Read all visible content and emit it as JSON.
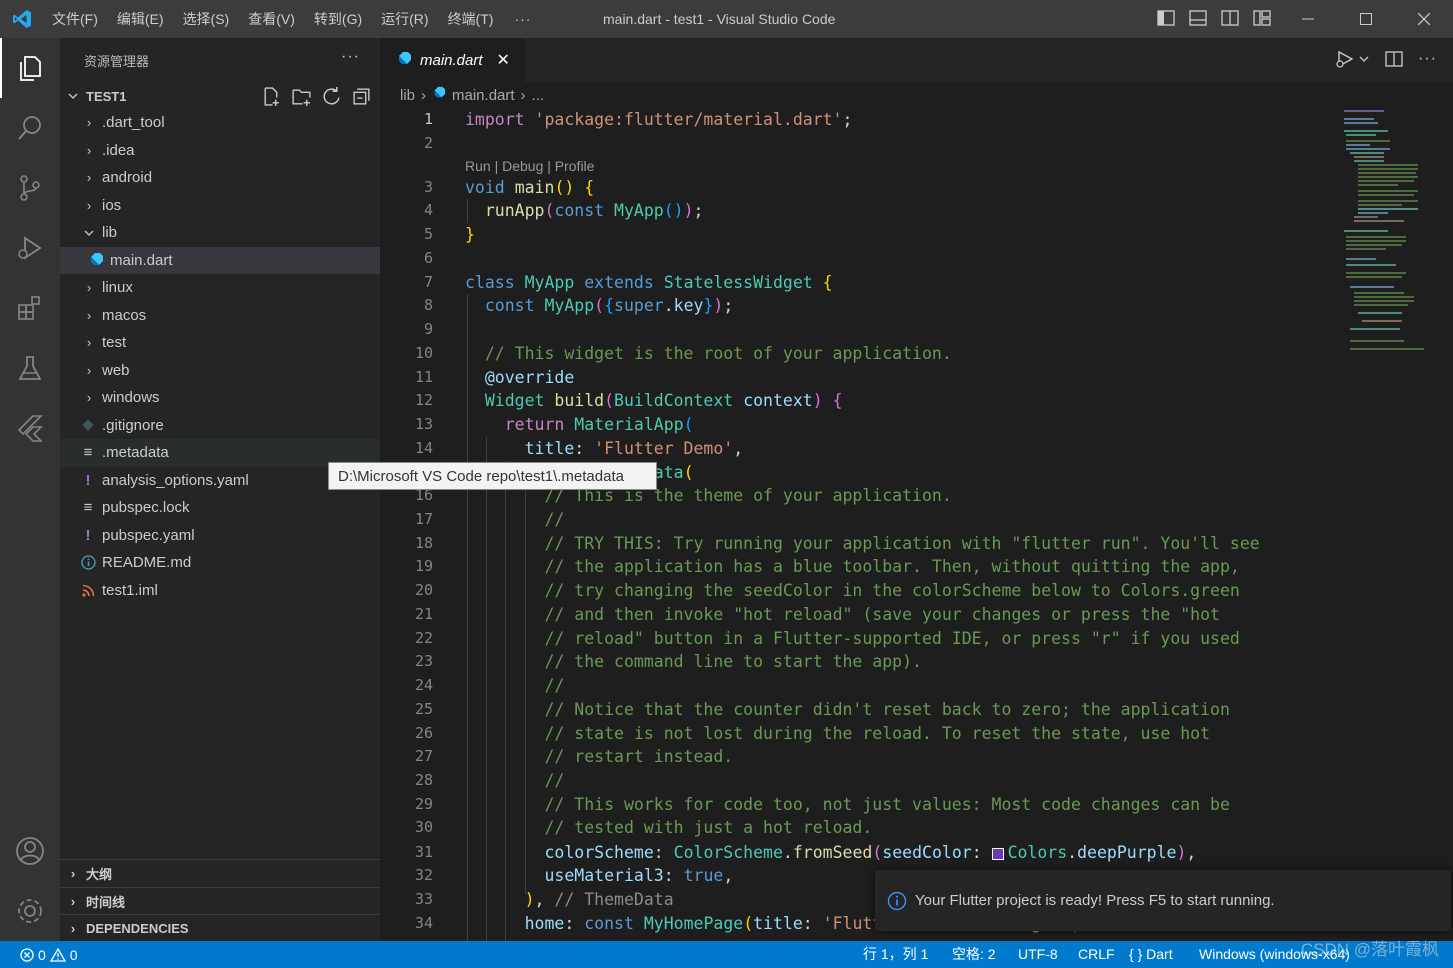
{
  "titlebar": {
    "menu": [
      "文件(F)",
      "编辑(E)",
      "选择(S)",
      "查看(V)",
      "转到(G)",
      "运行(R)",
      "终端(T)"
    ],
    "more": "···",
    "title": "main.dart - test1 - Visual Studio Code"
  },
  "sidebar": {
    "header": "资源管理器",
    "more": "···",
    "folder": "TEST1",
    "tree": [
      {
        "label": ".dart_tool",
        "type": "folder"
      },
      {
        "label": ".idea",
        "type": "folder"
      },
      {
        "label": "android",
        "type": "folder"
      },
      {
        "label": "ios",
        "type": "folder"
      },
      {
        "label": "lib",
        "type": "folder-open"
      },
      {
        "label": "main.dart",
        "type": "dart"
      },
      {
        "label": "linux",
        "type": "folder"
      },
      {
        "label": "macos",
        "type": "folder"
      },
      {
        "label": "test",
        "type": "folder"
      },
      {
        "label": "web",
        "type": "folder"
      },
      {
        "label": "windows",
        "type": "folder"
      },
      {
        "label": ".gitignore",
        "type": "git"
      },
      {
        "label": ".metadata",
        "type": "lines"
      },
      {
        "label": "analysis_options.yaml",
        "type": "yaml"
      },
      {
        "label": "pubspec.lock",
        "type": "lines"
      },
      {
        "label": "pubspec.yaml",
        "type": "yaml"
      },
      {
        "label": "README.md",
        "type": "info"
      },
      {
        "label": "test1.iml",
        "type": "rss"
      }
    ],
    "sections": [
      "大纲",
      "时间线",
      "DEPENDENCIES"
    ]
  },
  "editor": {
    "tab": "main.dart",
    "tab_close": "✕",
    "breadcrumb": {
      "folder": "lib",
      "file": "main.dart",
      "more": "..."
    },
    "codelens": "Run | Debug | Profile",
    "line_numbers": [
      "1",
      "2",
      "3",
      "4",
      "5",
      "6",
      "7",
      "8",
      "9",
      "10",
      "11",
      "12",
      "13",
      "14",
      "16",
      "17",
      "18",
      "19",
      "20",
      "21",
      "22",
      "23",
      "24",
      "25",
      "26",
      "27",
      "28",
      "29",
      "30",
      "31",
      "32",
      "33",
      "34"
    ],
    "comments": {
      "c10": "// This widget is the root of your application.",
      "c16": "// This is the theme of your application.",
      "c17": "//",
      "c18": "// TRY THIS: Try running your application with \"flutter run\". You'll see",
      "c19": "// the application has a blue toolbar. Then, without quitting the app,",
      "c20": "// try changing the seedColor in the colorScheme below to Colors.green",
      "c21": "// and then invoke \"hot reload\" (save your changes or press the \"hot",
      "c22": "// reload\" button in a Flutter-supported IDE, or press \"r\" if you used",
      "c23": "// the command line to start the app).",
      "c24": "//",
      "c25": "// Notice that the counter didn't reset back to zero; the application",
      "c26": "// state is not lost during the reload. To reset the state, use hot",
      "c27": "// restart instead.",
      "c28": "//",
      "c29": "// This works for code too, not just values: Most code changes can be",
      "c30": "// tested with just a hot reload.",
      "c33": "// ThemeData"
    },
    "strings": {
      "import": "'package:flutter/material.dart'",
      "title": "'Flutter Demo'",
      "home_title": "'Flutter Demo Home Page'"
    }
  },
  "tooltip": "D:\\Microsoft VS Code repo\\test1\\.metadata",
  "notification": "Your Flutter project is ready! Press F5 to start running.",
  "statusbar": {
    "errors": "0",
    "warnings": "0",
    "position": "行 1，列 1",
    "spaces": "空格: 2",
    "encoding": "UTF-8",
    "eol": "CRLF",
    "language": "Dart",
    "platform": "Windows (windows-x64)"
  },
  "watermark": "CSDN @落叶霞枫",
  "colors": {
    "accent": "#007acc",
    "titlebar": "#3c3c3c",
    "sidebar": "#252526",
    "editor": "#1e1e1e"
  }
}
